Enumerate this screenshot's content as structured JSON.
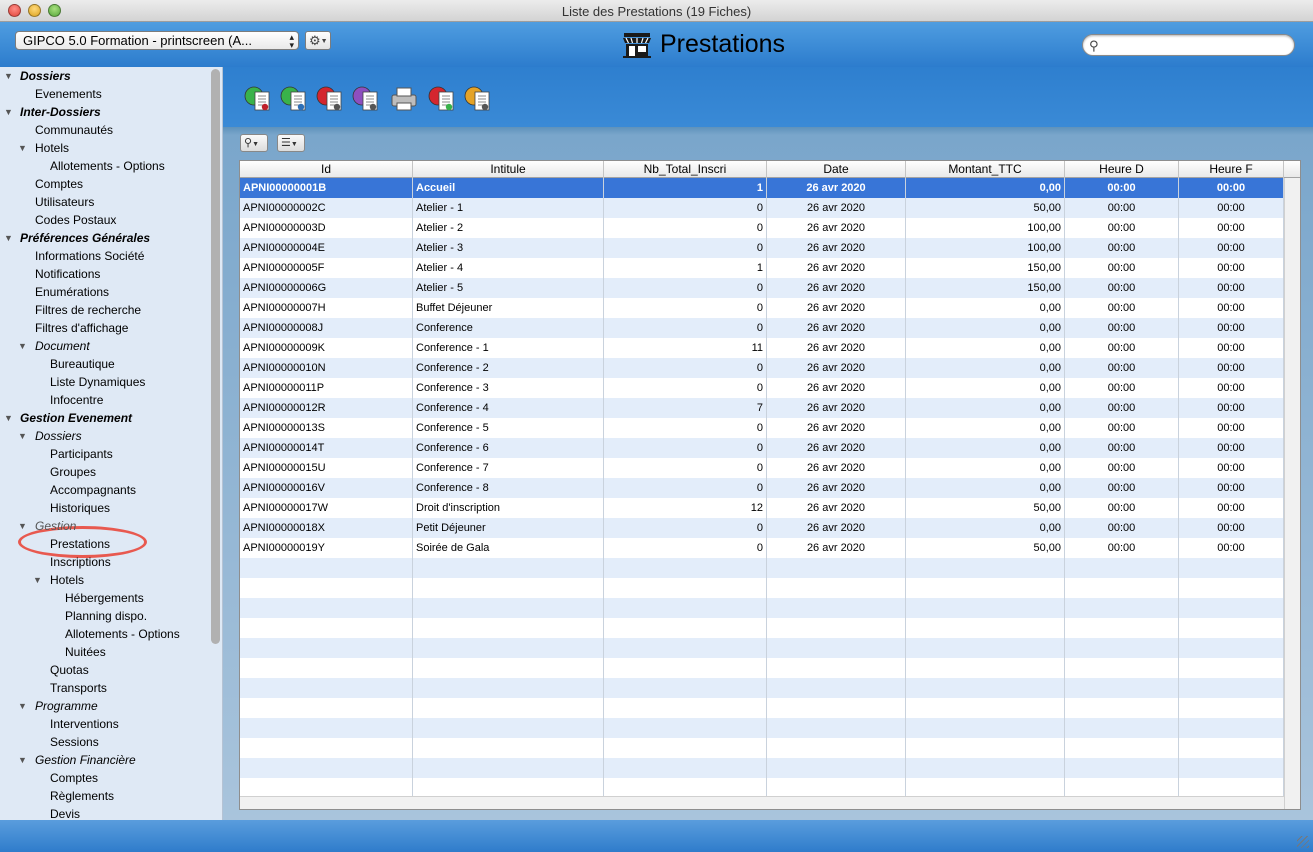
{
  "window": {
    "title": "Liste des Prestations (19 Fiches)"
  },
  "header": {
    "db_select": "GIPCO 5.0 Formation - printscreen (A...",
    "app_title": "Prestations",
    "search_placeholder": ""
  },
  "sidebar": {
    "items": [
      {
        "label": "Dossiers",
        "level": 0,
        "style": "bold",
        "expanded": true
      },
      {
        "label": "Evenements",
        "level": 1
      },
      {
        "label": "Inter-Dossiers",
        "level": 0,
        "style": "bold",
        "expanded": true
      },
      {
        "label": "Communautés",
        "level": 1
      },
      {
        "label": "Hotels",
        "level": 1,
        "expanded": true
      },
      {
        "label": "Allotements - Options",
        "level": 2
      },
      {
        "label": "Comptes",
        "level": 1
      },
      {
        "label": "Utilisateurs",
        "level": 1
      },
      {
        "label": "Codes Postaux",
        "level": 1
      },
      {
        "label": "Préférences Générales",
        "level": 0,
        "style": "bold",
        "expanded": true
      },
      {
        "label": "Informations Société",
        "level": 1
      },
      {
        "label": "Notifications",
        "level": 1
      },
      {
        "label": "Enumérations",
        "level": 1
      },
      {
        "label": "Filtres de recherche",
        "level": 1
      },
      {
        "label": "Filtres d'affichage",
        "level": 1
      },
      {
        "label": "Document",
        "level": 1,
        "style": "ital",
        "expanded": true
      },
      {
        "label": "Bureautique",
        "level": 2
      },
      {
        "label": "Liste Dynamiques",
        "level": 2
      },
      {
        "label": "Infocentre",
        "level": 2
      },
      {
        "label": "Gestion Evenement",
        "level": 0,
        "style": "bold",
        "expanded": true
      },
      {
        "label": "Dossiers",
        "level": 1,
        "style": "ital",
        "expanded": true
      },
      {
        "label": "Participants",
        "level": 2
      },
      {
        "label": "Groupes",
        "level": 2
      },
      {
        "label": "Accompagnants",
        "level": 2
      },
      {
        "label": "Historiques",
        "level": 2
      },
      {
        "label": "Gestion",
        "level": 1,
        "style": "ital",
        "expanded": true,
        "dim": true
      },
      {
        "label": "Prestations",
        "level": 2,
        "selected": true
      },
      {
        "label": "Inscriptions",
        "level": 2
      },
      {
        "label": "Hotels",
        "level": 2,
        "expanded": true
      },
      {
        "label": "Hébergements",
        "level": 3
      },
      {
        "label": "Planning dispo.",
        "level": 3
      },
      {
        "label": "Allotements - Options",
        "level": 3
      },
      {
        "label": "Nuitées",
        "level": 3
      },
      {
        "label": "Quotas",
        "level": 2
      },
      {
        "label": "Transports",
        "level": 2
      },
      {
        "label": "Programme",
        "level": 1,
        "style": "ital",
        "expanded": true
      },
      {
        "label": "Interventions",
        "level": 2
      },
      {
        "label": "Sessions",
        "level": 2
      },
      {
        "label": "Gestion Financière",
        "level": 1,
        "style": "ital",
        "expanded": true
      },
      {
        "label": "Comptes",
        "level": 2
      },
      {
        "label": "Règlements",
        "level": 2
      },
      {
        "label": "Devis",
        "level": 2
      }
    ]
  },
  "toolbar": {
    "icons": [
      "new-record-icon",
      "edit-record-icon",
      "delete-record-icon",
      "search-record-icon",
      "print-icon",
      "export-icon",
      "table-view-icon"
    ]
  },
  "table": {
    "columns": [
      "Id",
      "Intitule",
      "Nb_Total_Inscri",
      "Date",
      "Montant_TTC",
      "Heure D",
      "Heure F"
    ],
    "rows": [
      [
        "APNI00000001B",
        "Accueil",
        "1",
        "26 avr 2020",
        "0,00",
        "00:00",
        "00:00"
      ],
      [
        "APNI00000002C",
        "Atelier - 1",
        "0",
        "26 avr 2020",
        "50,00",
        "00:00",
        "00:00"
      ],
      [
        "APNI00000003D",
        "Atelier - 2",
        "0",
        "26 avr 2020",
        "100,00",
        "00:00",
        "00:00"
      ],
      [
        "APNI00000004E",
        "Atelier - 3",
        "0",
        "26 avr 2020",
        "100,00",
        "00:00",
        "00:00"
      ],
      [
        "APNI00000005F",
        "Atelier - 4",
        "1",
        "26 avr 2020",
        "150,00",
        "00:00",
        "00:00"
      ],
      [
        "APNI00000006G",
        "Atelier - 5",
        "0",
        "26 avr 2020",
        "150,00",
        "00:00",
        "00:00"
      ],
      [
        "APNI00000007H",
        "Buffet Déjeuner",
        "0",
        "26 avr 2020",
        "0,00",
        "00:00",
        "00:00"
      ],
      [
        "APNI00000008J",
        "Conference",
        "0",
        "26 avr 2020",
        "0,00",
        "00:00",
        "00:00"
      ],
      [
        "APNI00000009K",
        "Conference - 1",
        "11",
        "26 avr 2020",
        "0,00",
        "00:00",
        "00:00"
      ],
      [
        "APNI00000010N",
        "Conference - 2",
        "0",
        "26 avr 2020",
        "0,00",
        "00:00",
        "00:00"
      ],
      [
        "APNI00000011P",
        "Conference - 3",
        "0",
        "26 avr 2020",
        "0,00",
        "00:00",
        "00:00"
      ],
      [
        "APNI00000012R",
        "Conference - 4",
        "7",
        "26 avr 2020",
        "0,00",
        "00:00",
        "00:00"
      ],
      [
        "APNI00000013S",
        "Conference - 5",
        "0",
        "26 avr 2020",
        "0,00",
        "00:00",
        "00:00"
      ],
      [
        "APNI00000014T",
        "Conference - 6",
        "0",
        "26 avr 2020",
        "0,00",
        "00:00",
        "00:00"
      ],
      [
        "APNI00000015U",
        "Conference - 7",
        "0",
        "26 avr 2020",
        "0,00",
        "00:00",
        "00:00"
      ],
      [
        "APNI00000016V",
        "Conference - 8",
        "0",
        "26 avr 2020",
        "0,00",
        "00:00",
        "00:00"
      ],
      [
        "APNI00000017W",
        "Droit d'inscription",
        "12",
        "26 avr 2020",
        "50,00",
        "00:00",
        "00:00"
      ],
      [
        "APNI00000018X",
        "Petit Déjeuner",
        "0",
        "26 avr 2020",
        "0,00",
        "00:00",
        "00:00"
      ],
      [
        "APNI00000019Y",
        "Soirée de Gala",
        "0",
        "26 avr 2020",
        "50,00",
        "00:00",
        "00:00"
      ]
    ],
    "selected_row": 0
  },
  "colors": {
    "header_blue": "#2c7ccd",
    "selection_blue": "#3875d7",
    "row_alt": "#e3edfa",
    "sidebar_bg": "#dfe9f5",
    "highlight_ring": "#e8594f"
  }
}
